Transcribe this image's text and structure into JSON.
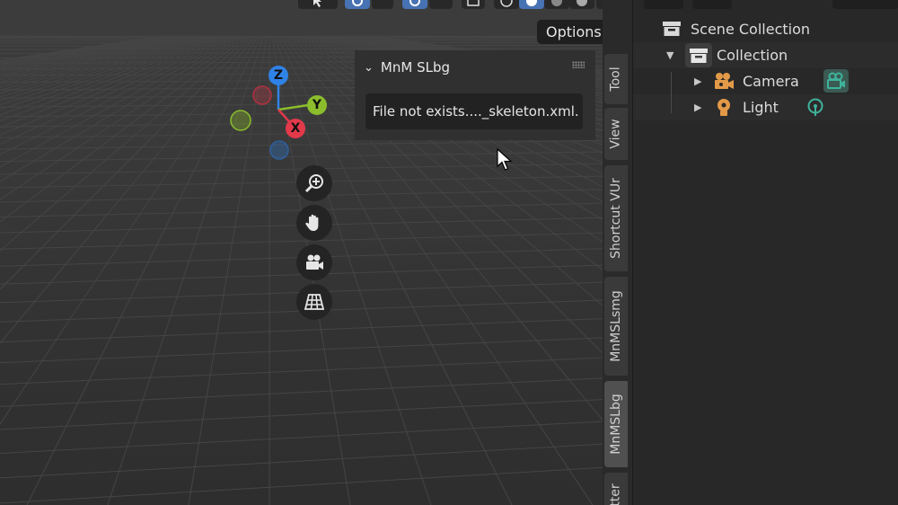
{
  "viewport": {
    "options_label": "Options",
    "gizmo": {
      "z_label": "Z",
      "y_label": "Y",
      "x_label": "X"
    },
    "panel": {
      "title": "MnM SLbg",
      "message": "File not exists...._skeleton.xml."
    },
    "tabs": [
      {
        "label": "Tool",
        "active": false
      },
      {
        "label": "View",
        "active": false
      },
      {
        "label": "Shortcut VUr",
        "active": false
      },
      {
        "label": "MnMSLsmg",
        "active": false
      },
      {
        "label": "MnMSLbg",
        "active": true
      },
      {
        "label": "tter",
        "active": false
      }
    ]
  },
  "outliner": {
    "scene_collection": "Scene Collection",
    "collection": "Collection",
    "items": [
      {
        "label": "Camera",
        "type": "camera"
      },
      {
        "label": "Light",
        "type": "light"
      }
    ]
  },
  "colors": {
    "accent_blue": "#4772b3",
    "axis_x": "#e2394b",
    "axis_y": "#8bbd2c",
    "axis_z": "#2f82e6",
    "camera_data": "#3fb39c",
    "object_orange": "#e39a48"
  }
}
